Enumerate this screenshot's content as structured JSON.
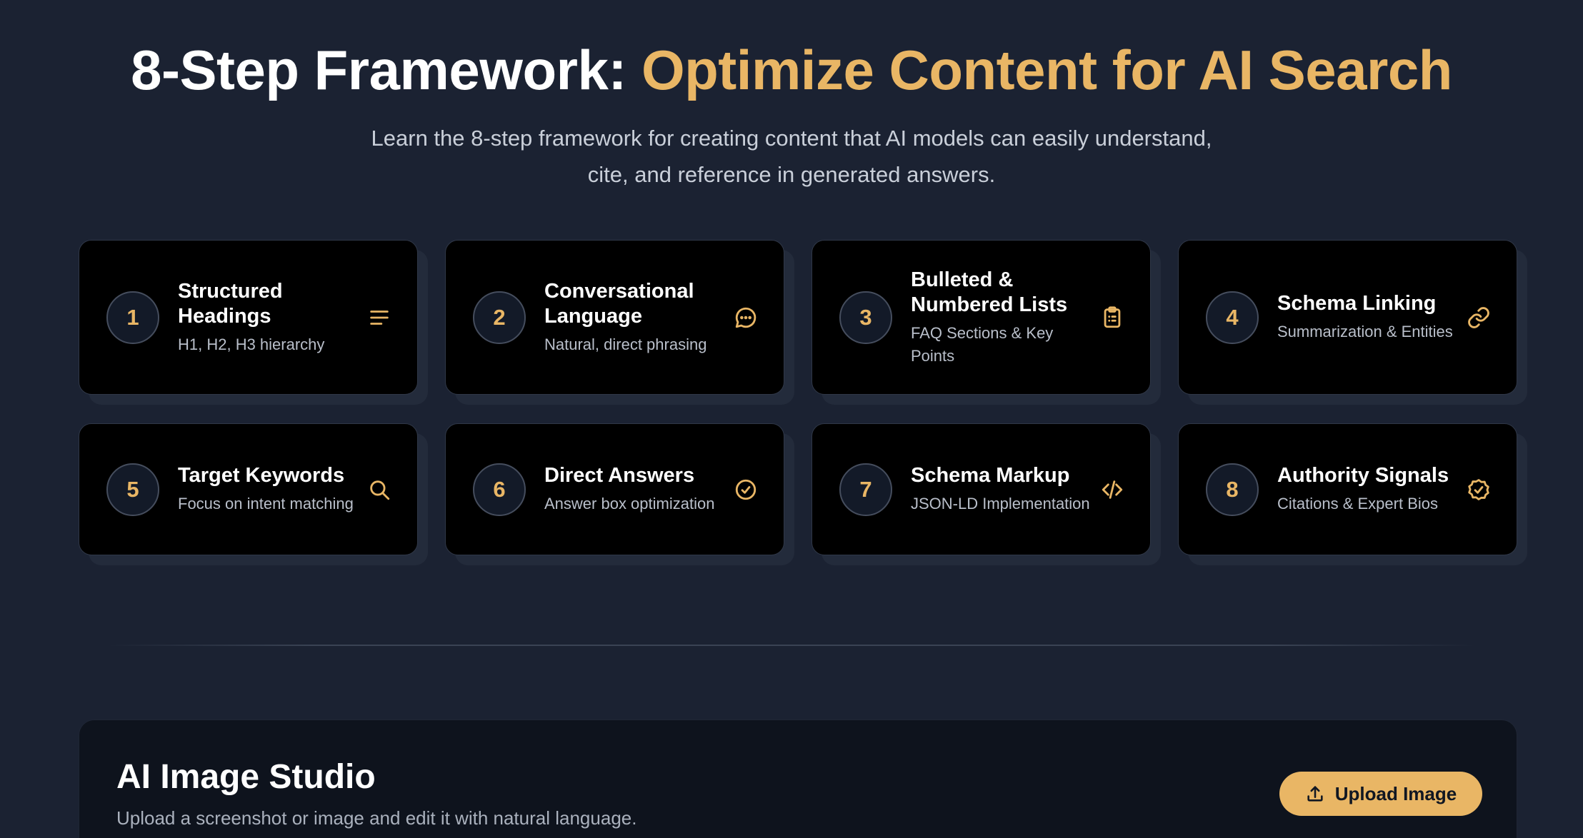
{
  "hero": {
    "title_main": "8-Step Framework: ",
    "title_accent": "Optimize Content for AI Search",
    "subtitle": "Learn the 8-step framework for creating content that AI models can easily understand, cite, and reference in generated answers."
  },
  "steps": [
    {
      "number": "1",
      "title": "Structured Headings",
      "desc": "H1, H2, H3 hierarchy",
      "icon": "align-left-icon"
    },
    {
      "number": "2",
      "title": "Conversational Language",
      "desc": "Natural, direct phrasing",
      "icon": "chat-bubble-icon"
    },
    {
      "number": "3",
      "title": "Bulleted & Numbered Lists",
      "desc": "FAQ Sections & Key Points",
      "icon": "clipboard-list-icon"
    },
    {
      "number": "4",
      "title": "Schema Linking",
      "desc": "Summarization & Entities",
      "icon": "link-icon"
    },
    {
      "number": "5",
      "title": "Target Keywords",
      "desc": "Focus on intent matching",
      "icon": "search-icon"
    },
    {
      "number": "6",
      "title": "Direct Answers",
      "desc": "Answer box optimization",
      "icon": "check-circle-icon"
    },
    {
      "number": "7",
      "title": "Schema Markup",
      "desc": "JSON-LD Implementation",
      "icon": "code-icon"
    },
    {
      "number": "8",
      "title": "Authority Signals",
      "desc": "Citations & Expert Bios",
      "icon": "badge-check-icon"
    }
  ],
  "studio": {
    "title": "AI Image Studio",
    "subtitle": "Upload a screenshot or image and edit it with natural language.",
    "upload_label": "Upload Image"
  },
  "colors": {
    "accent": "#e9b665",
    "background": "#1b2232",
    "card": "#000000"
  }
}
